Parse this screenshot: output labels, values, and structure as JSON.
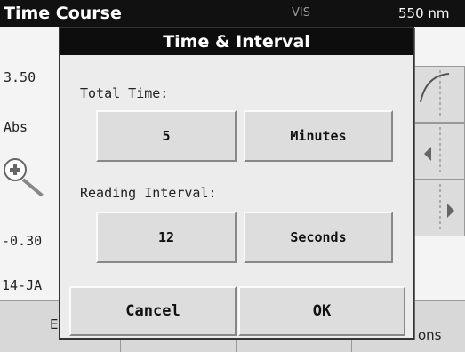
{
  "app": {
    "title": "Time Course",
    "mode": "VIS",
    "wavelength": "550 nm",
    "y_max": "3.50",
    "y_label": "Abs",
    "y_min": "-0.30",
    "date": "14-JA",
    "bottom_left_label": "E",
    "bottom_right_label": "ons"
  },
  "dialog": {
    "title": "Time & Interval",
    "total_time": {
      "label": "Total Time:",
      "value": "5",
      "unit": "Minutes"
    },
    "reading_interval": {
      "label": "Reading Interval:",
      "value": "12",
      "unit": "Seconds"
    },
    "cancel_label": "Cancel",
    "ok_label": "OK"
  }
}
